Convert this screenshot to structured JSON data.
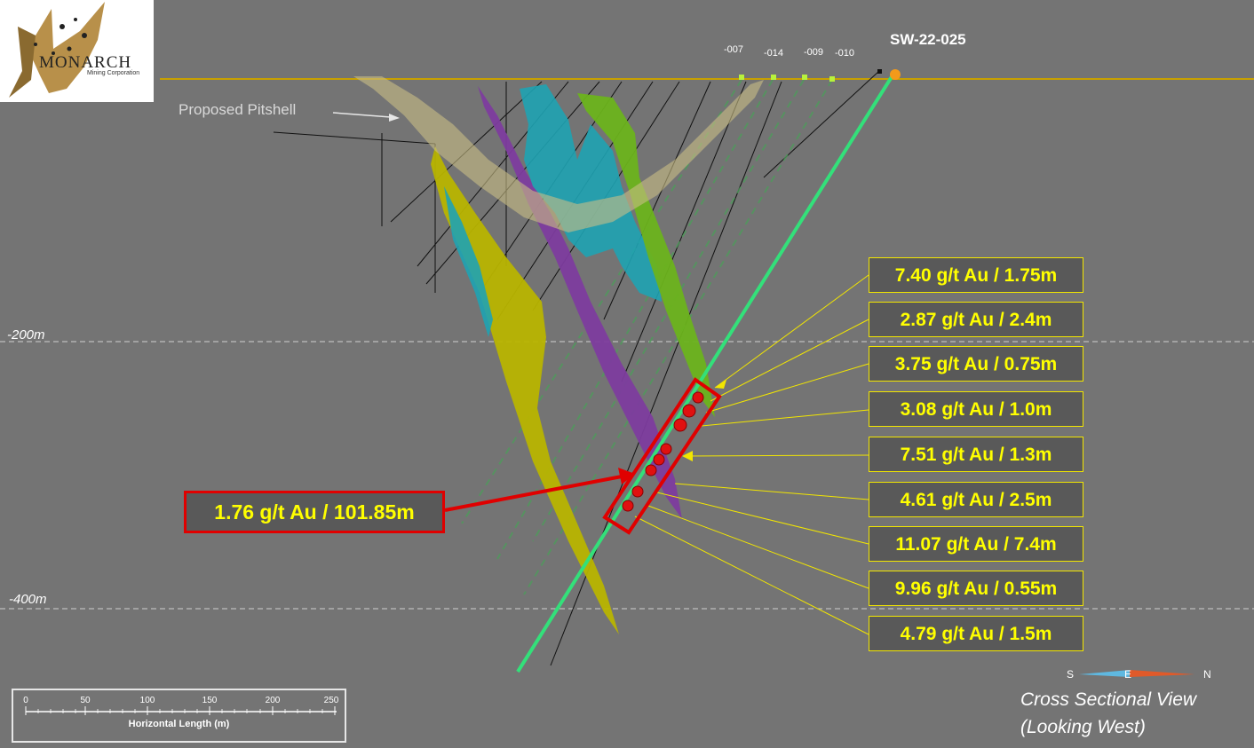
{
  "logo": {
    "brand": "MONARCH",
    "subtitle": "Mining Corporation"
  },
  "drillhole": {
    "name": "SW-22-025",
    "nearby": [
      "-007",
      "-014",
      "-009",
      "-010"
    ]
  },
  "labels": {
    "pitshell": "Proposed Pitshell",
    "depths": [
      "-200m",
      "-400m"
    ]
  },
  "summary_intercept": "1.76 g/t Au / 101.85m",
  "intercepts": [
    "7.40 g/t Au / 1.75m",
    "2.87 g/t Au / 2.4m",
    "3.75 g/t Au / 0.75m",
    "3.08 g/t Au / 1.0m",
    "7.51 g/t Au / 1.3m",
    "4.61 g/t Au / 2.5m",
    "11.07 g/t Au / 7.4m",
    "9.96 g/t Au / 0.55m",
    "4.79 g/t Au / 1.5m"
  ],
  "scale_bar": {
    "ticks": [
      "0",
      "50",
      "100",
      "150",
      "200",
      "250"
    ],
    "title": "Horizontal Length (m)"
  },
  "compass": {
    "left": "S",
    "middle": "E",
    "right": "N"
  },
  "view": {
    "line1": "Cross Sectional View",
    "line2": "(Looking West)"
  },
  "colors": {
    "background": "#747474",
    "drillhole": "#33e07a",
    "intercept_text": "#ffff00",
    "highlight": "#e00000",
    "zone_yellow": "#b8b400",
    "zone_purple": "#7d3c9e",
    "zone_cyan": "#1fa3b3",
    "zone_green": "#6cb31c",
    "pitshell": "#c9be86"
  }
}
